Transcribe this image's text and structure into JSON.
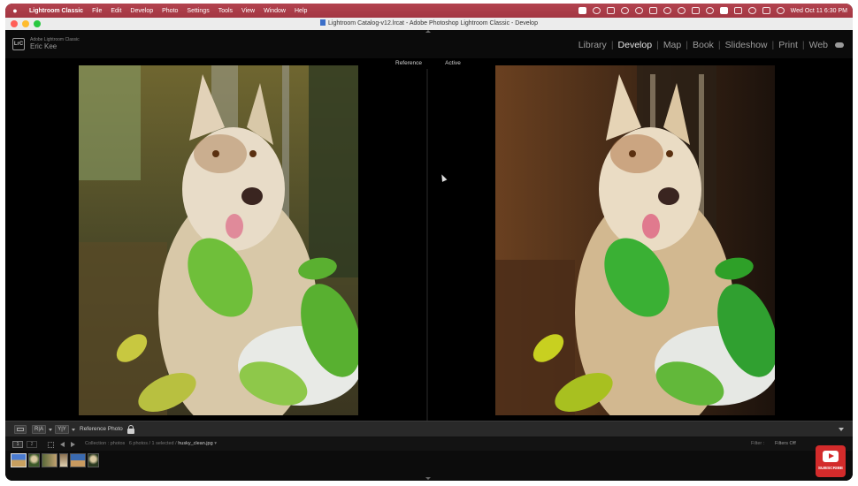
{
  "menubar": {
    "apple": "",
    "items": [
      "Lightroom Classic",
      "File",
      "Edit",
      "Develop",
      "Photo",
      "Settings",
      "Tools",
      "View",
      "Window",
      "Help"
    ],
    "datetime": "Wed Oct 11  6:30 PM"
  },
  "window": {
    "title": "Lightroom Catalog-v12.lrcat - Adobe Photoshop Lightroom Classic - Develop",
    "traffic_lights": [
      "#ff5f57",
      "#febc2e",
      "#28c840"
    ]
  },
  "identity": {
    "logo": "LrC",
    "product": "Adobe Lightroom Classic",
    "user": "Eric Kee"
  },
  "modules": [
    {
      "label": "Library",
      "active": false
    },
    {
      "label": "Develop",
      "active": true
    },
    {
      "label": "Map",
      "active": false
    },
    {
      "label": "Book",
      "active": false
    },
    {
      "label": "Slideshow",
      "active": false
    },
    {
      "label": "Print",
      "active": false
    },
    {
      "label": "Web",
      "active": false
    }
  ],
  "compare": {
    "reference_label": "Reference",
    "active_label": "Active"
  },
  "toolbar": {
    "ra_label": "R|A",
    "ra2_label": "Y|Y",
    "reference_photo_label": "Reference Photo"
  },
  "filmstrip": {
    "page1": "1",
    "page2": "2",
    "source_prefix": "Collection : photos",
    "source_count": "6 photos / 1 selected /",
    "filename": "husky_clean.jpg",
    "filter_label": "Filter :",
    "filter_value": "Filters Off",
    "thumbnails": [
      {
        "name": "thumb-1",
        "colors": [
          "#4a7bd0",
          "#c8a060"
        ],
        "selected": true
      },
      {
        "name": "thumb-2",
        "colors": [
          "#3d5a2a",
          "#d8c8a0"
        ],
        "selected": false
      },
      {
        "name": "thumb-3",
        "colors": [
          "#5a6a3a",
          "#c0a070"
        ],
        "selected": false
      },
      {
        "name": "thumb-4",
        "colors": [
          "#8a7050",
          "#e0d0b0"
        ],
        "selected": false
      },
      {
        "name": "thumb-5",
        "colors": [
          "#3a6ab0",
          "#c89a60"
        ],
        "selected": false
      },
      {
        "name": "thumb-6",
        "colors": [
          "#2a3a20",
          "#d8c8a0"
        ],
        "selected": false
      }
    ]
  },
  "overlay": {
    "subscribe_label": "SUBSCRIBE"
  },
  "colors": {
    "menubar": "#a83a46",
    "panel_bg": "#111111",
    "active_module": "#e4e4e4"
  }
}
